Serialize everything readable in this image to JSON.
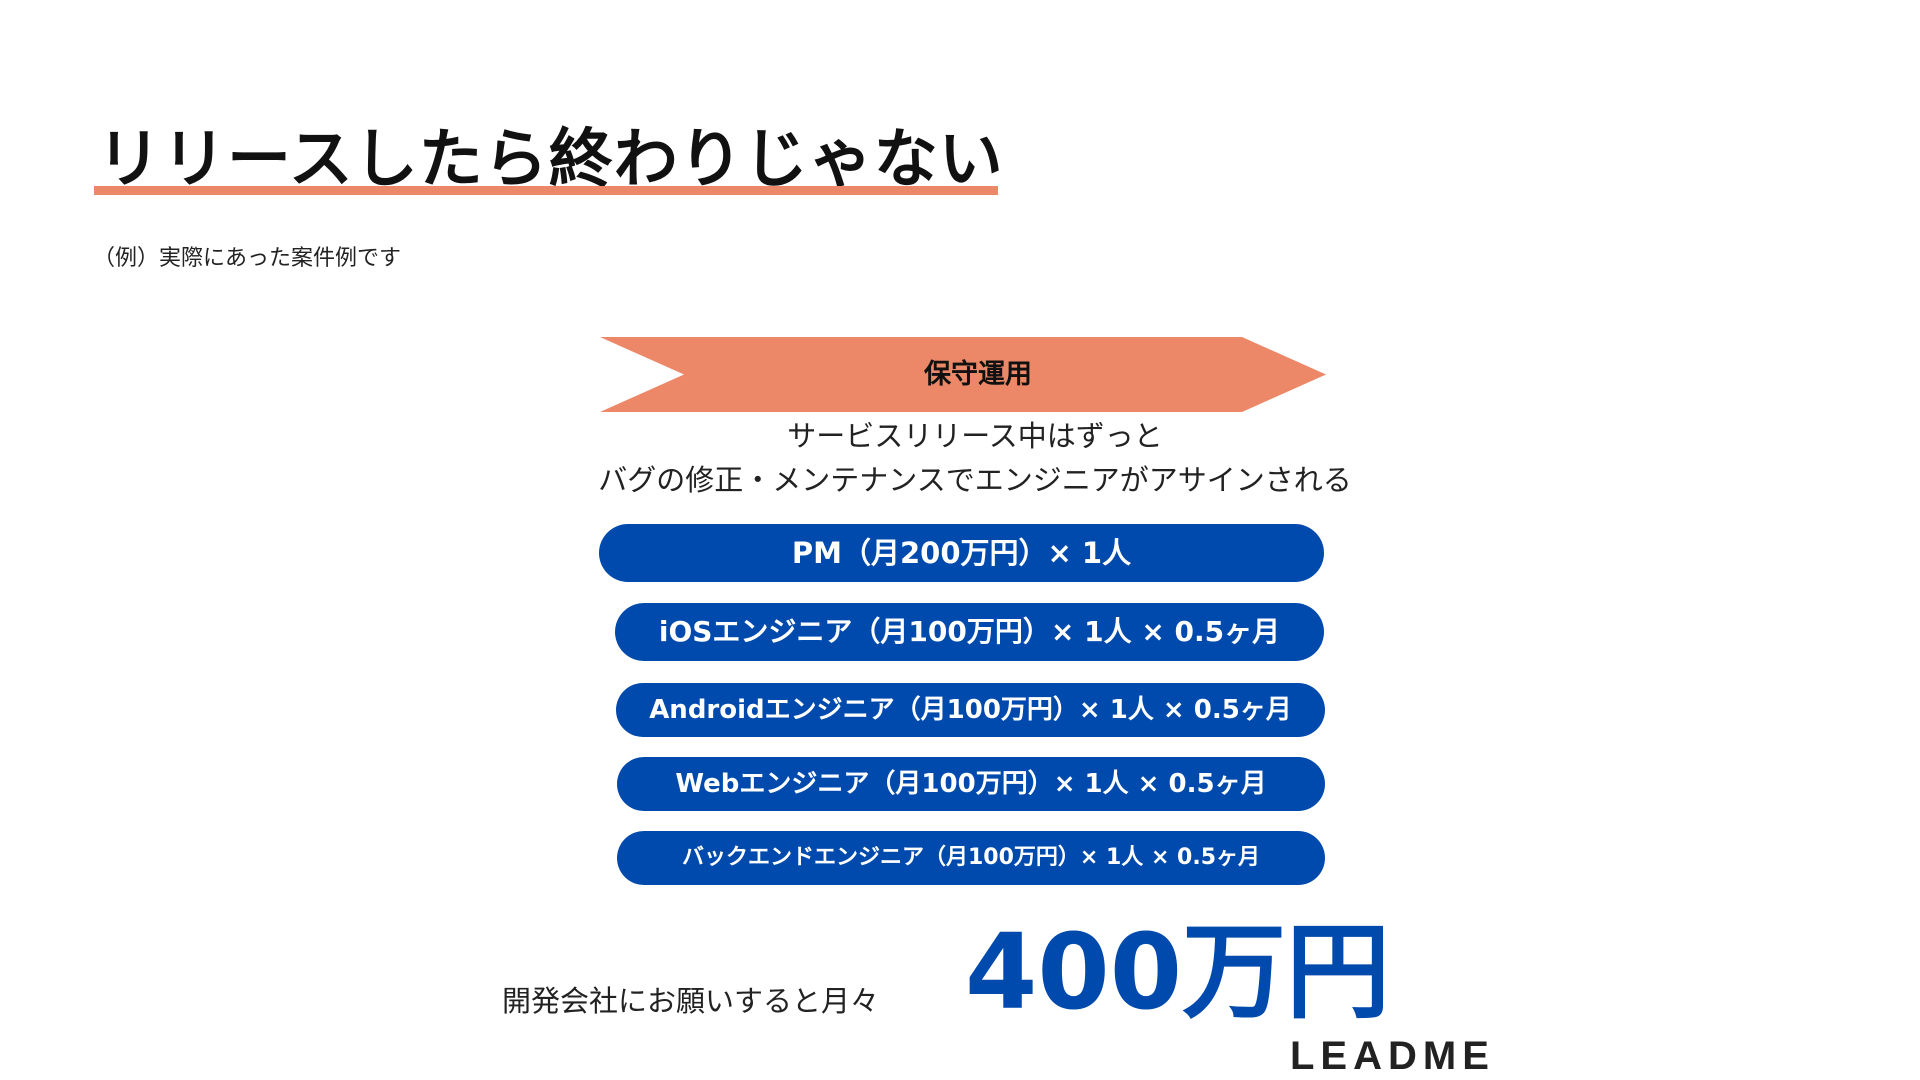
{
  "slide": {
    "title": "リリースしたら終わりじゃない",
    "subtitle": "（例）実際にあった案件例です",
    "phase": {
      "label": "保守運用"
    },
    "description": {
      "line1": "サービスリリース中はずっと",
      "line2": "バグの修正・メンテナンスでエンジニアがアサインされる"
    },
    "roles": [
      {
        "label": "PM（月200万円）× 1人"
      },
      {
        "label": "iOSエンジニア（月100万円）× 1人 × 0.5ヶ月"
      },
      {
        "label": "Androidエンジニア（月100万円）× 1人 × 0.5ヶ月"
      },
      {
        "label": "Webエンジニア（月100万円）× 1人 × 0.5ヶ月"
      },
      {
        "label": "バックエンドエンジニア（月100万円）× 1人 × 0.5ヶ月"
      }
    ],
    "total": {
      "label": "開発会社にお願いすると月々",
      "amount": "400万円"
    },
    "logo": "LEADME"
  },
  "colors": {
    "accent_orange": "#ec8767",
    "brand_blue": "#004aad",
    "text": "#111111",
    "background": "#ffffff"
  }
}
